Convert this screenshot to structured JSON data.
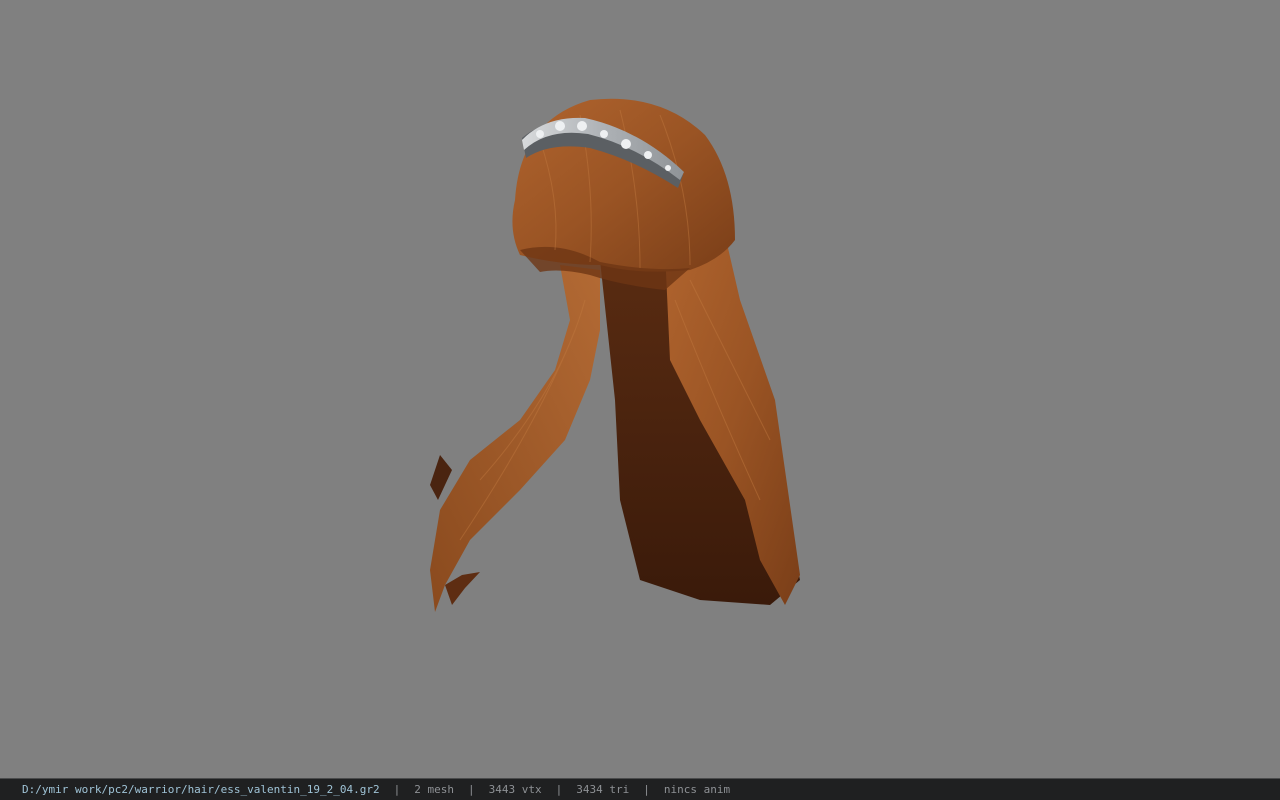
{
  "viewport": {
    "background_color": "#808080",
    "model": {
      "subject": "long auburn hair with silver tiara",
      "hair_color": "#a45a2a",
      "hair_shadow_color": "#4a2410",
      "tiara_color": "#c9cccf"
    }
  },
  "status_bar": {
    "file_path": "D:/ymir work/pc2/warrior/hair/ess_valentin_19_2_04.gr2",
    "separator": "|",
    "mesh_count": "2 mesh",
    "vertex_count": "3443 vtx",
    "triangle_count": "3434 tri",
    "animation": "nincs anim"
  }
}
